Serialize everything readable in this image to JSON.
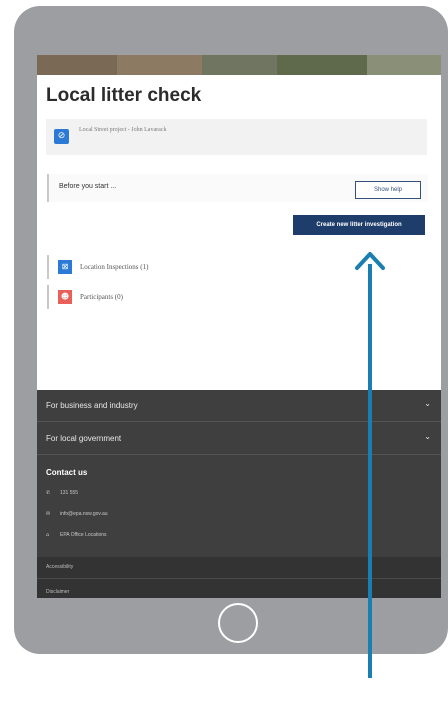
{
  "page": {
    "title": "Local litter check",
    "project": {
      "icon": "compass-icon",
      "text": "Local Street project - John Lavarack"
    },
    "before_start": {
      "label": "Before you start ...",
      "help_button": "Show help"
    },
    "create_button": "Create new litter investigation",
    "nav_items": [
      {
        "label": "Location Inspections (1)",
        "icon": "location-inspection-icon",
        "color": "#2b7bd6"
      },
      {
        "label": "Participants (0)",
        "icon": "participants-icon",
        "color": "#e8605a"
      }
    ]
  },
  "footer": {
    "accordions": [
      {
        "label": "For business and industry"
      },
      {
        "label": "For local government"
      }
    ],
    "contact": {
      "title": "Contact us",
      "phone": "131 555",
      "email": "info@epa.nsw.gov.au",
      "office": "EPA Office Locations"
    },
    "links": [
      "Accessibility",
      "Disclaimer"
    ]
  },
  "colors": {
    "primary_button": "#1f3d6b",
    "annotation_arrow": "#1a7fb0",
    "tablet_frame": "#9d9ea2",
    "footer_bg": "#3f3f3f"
  }
}
